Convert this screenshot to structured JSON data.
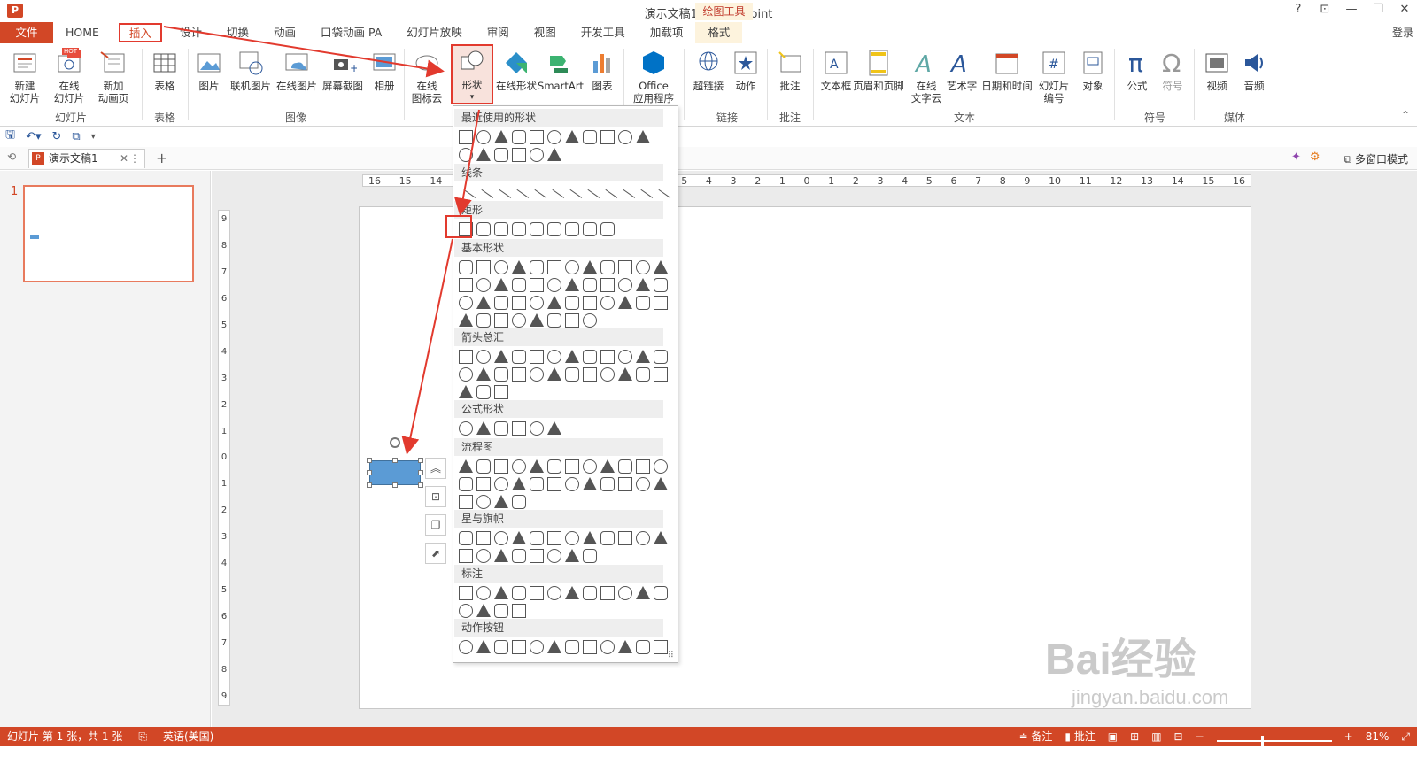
{
  "window": {
    "app_icon": "P",
    "title": "演示文稿1 - PowerPoint",
    "controls": [
      "?",
      "⊡",
      "—",
      "❐",
      "✕"
    ],
    "context_tab_group": "绘图工具",
    "login": "登录"
  },
  "tabs": [
    "文件",
    "HOME",
    "插入",
    "设计",
    "切换",
    "动画",
    "口袋动画 PA",
    "幻灯片放映",
    "审阅",
    "视图",
    "开发工具",
    "加载项",
    "格式"
  ],
  "ribbon": {
    "buttons": {
      "new_slide": "新建\n幻灯片",
      "online_slide": "在线\n幻灯片",
      "add_anim": "新加\n动画页",
      "table": "表格",
      "picture": "图片",
      "link_pic": "联机图片",
      "online_pic": "在线图片",
      "screenshot": "屏幕截图",
      "album": "相册",
      "online_icon": "在线\n图标云",
      "shapes": "形状",
      "online_shapes": "在线形状",
      "smartart": "SmartArt",
      "chart": "图表",
      "office_apps": "Office\n应用程序",
      "hyperlink": "超链接",
      "action": "动作",
      "comment": "批注",
      "textbox": "文本框",
      "header_footer": "页眉和页脚",
      "online_wordcloud": "在线\n文字云",
      "wordart": "艺术字",
      "datetime": "日期和时间",
      "slide_number": "幻灯片\n编号",
      "object": "对象",
      "equation": "公式",
      "symbol": "符号",
      "video": "视频",
      "audio": "音频",
      "hot_badge": "HOT"
    },
    "groups": {
      "slides": "幻灯片",
      "tables": "表格",
      "images": "图像",
      "links": "链接",
      "comments": "批注",
      "text": "文本",
      "symbols": "符号",
      "media": "媒体"
    }
  },
  "doc_tab": {
    "label": "演示文稿1",
    "multi_window": "多窗口模式"
  },
  "slide_panel": {
    "slide_number": "1"
  },
  "rulers": {
    "horizontal": [
      "16",
      "15",
      "14",
      "13",
      "12",
      "11",
      "10",
      "9",
      "8",
      "7",
      "6",
      "5",
      "4",
      "3",
      "2",
      "1",
      "0",
      "1",
      "2",
      "3",
      "4",
      "5",
      "6",
      "7",
      "8",
      "9",
      "10",
      "11",
      "12",
      "13",
      "14",
      "15",
      "16"
    ],
    "vertical": [
      "9",
      "8",
      "7",
      "6",
      "5",
      "4",
      "3",
      "2",
      "1",
      "0",
      "1",
      "2",
      "3",
      "4",
      "5",
      "6",
      "7",
      "8",
      "9"
    ]
  },
  "gallery": {
    "sections": [
      "最近使用的形状",
      "线条",
      "矩形",
      "基本形状",
      "箭头总汇",
      "公式形状",
      "流程图",
      "星与旗帜",
      "标注",
      "动作按钮"
    ]
  },
  "status": {
    "slide_info": "幻灯片 第 1 张，共 1 张",
    "language": "英语(美国)",
    "notes": "备注",
    "comments": "批注",
    "zoom": "81%"
  },
  "watermark": {
    "text": "Bai经验",
    "url": "jingyan.baidu.com"
  },
  "colors": {
    "accent": "#d24726",
    "highlight": "#e23a2e",
    "shape_fill": "#5b9bd5"
  }
}
